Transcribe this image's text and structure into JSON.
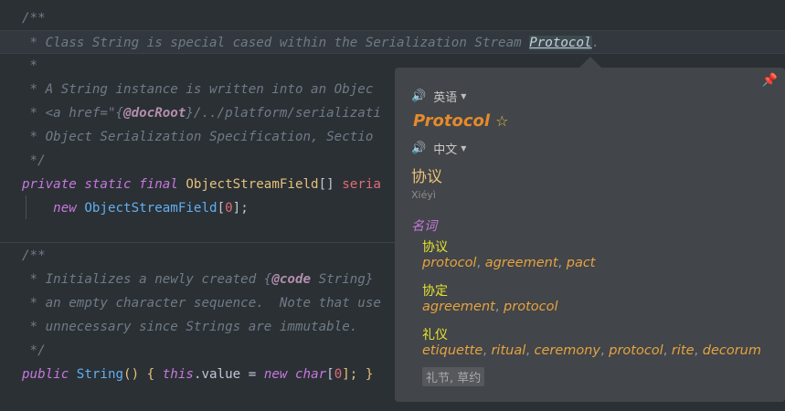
{
  "code": {
    "l1": "/**",
    "l2_pre": " * Class String is special cased within the Serialization Stream ",
    "l2_word": "Protocol",
    "l2_post": ".",
    "l3": " *",
    "l4": " * A String instance is written into an Objec",
    "l5_pre": " * <a href=\"{",
    "l5_tag": "@docRoot",
    "l5_post": "}/../platform/serializati",
    "l6": " * Object Serialization Specification, Sectio",
    "l7": " */",
    "l8_kw": "private static final",
    "l8_type": "ObjectStreamField",
    "l8_br": "[] ",
    "l8_field": "seria",
    "l9_kw": "new",
    "l9_type": "ObjectStreamField",
    "l9_open": "[",
    "l9_num": "0",
    "l9_close": "];",
    "l10": "/**",
    "l11_pre": " * Initializes a newly created {",
    "l11_tag": "@code",
    "l11_post": " String}",
    "l12": " * an empty character sequence.  Note that use",
    "l13": " * unnecessary since Strings are immutable.",
    "l14": " */",
    "l15_kw": "public",
    "l15_type": "String",
    "l15_a": "() { ",
    "l15_this": "this",
    "l15_b": ".value = ",
    "l15_new": "new",
    "l15_char": "char",
    "l15_open": "[",
    "l15_num": "0",
    "l15_close": "]; }"
  },
  "popup": {
    "source_lang": "英语",
    "headword": "Protocol",
    "star": "☆",
    "target_lang": "中文",
    "translation": "协议",
    "pinyin": "Xiéyì",
    "part_of_speech": "名词",
    "senses": [
      {
        "head": "协议",
        "words": [
          "protocol",
          "agreement",
          "pact"
        ]
      },
      {
        "head": "协定",
        "words": [
          "agreement",
          "protocol"
        ]
      },
      {
        "head": "礼仪",
        "words": [
          "etiquette",
          "ritual",
          "ceremony",
          "protocol",
          "rite",
          "decorum"
        ]
      }
    ],
    "extra_chip": "礼节, 草约",
    "icons": {
      "speaker": "speaker-icon",
      "pin": "pin-icon",
      "star": "star-icon",
      "caret": "caret-down-icon"
    },
    "colors": {
      "headword": "#e58a2c",
      "sense_head": "#e6e232",
      "sense_words": "#e5a340",
      "pos": "#c678dd"
    }
  }
}
